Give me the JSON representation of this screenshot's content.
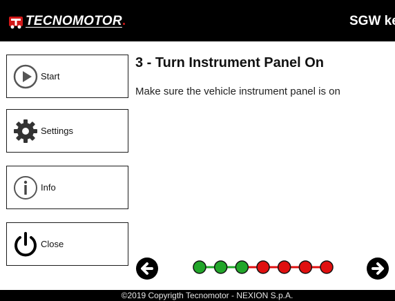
{
  "header": {
    "logo_text": "TECNOMOTOR",
    "logo_dot": ".",
    "title": "SGW key"
  },
  "sidebar": {
    "items": [
      {
        "label": "Start",
        "icon": "play-icon"
      },
      {
        "label": "Settings",
        "icon": "gear-icon"
      },
      {
        "label": "Info",
        "icon": "info-icon"
      },
      {
        "label": "Close",
        "icon": "power-icon"
      }
    ]
  },
  "step": {
    "heading": "3 - Turn Instrument Panel On",
    "description": "Make sure the vehicle instrument panel is on"
  },
  "progress": {
    "total_steps": 7,
    "completed_steps": 3,
    "colors": {
      "done": "#22a62a",
      "todo": "#e01010"
    }
  },
  "navigation": {
    "back_icon": "arrow-left-icon",
    "next_icon": "arrow-right-icon"
  },
  "footer": {
    "copyright": "©2019 Copyrigth Tecnomotor - NEXION S.p.A."
  }
}
